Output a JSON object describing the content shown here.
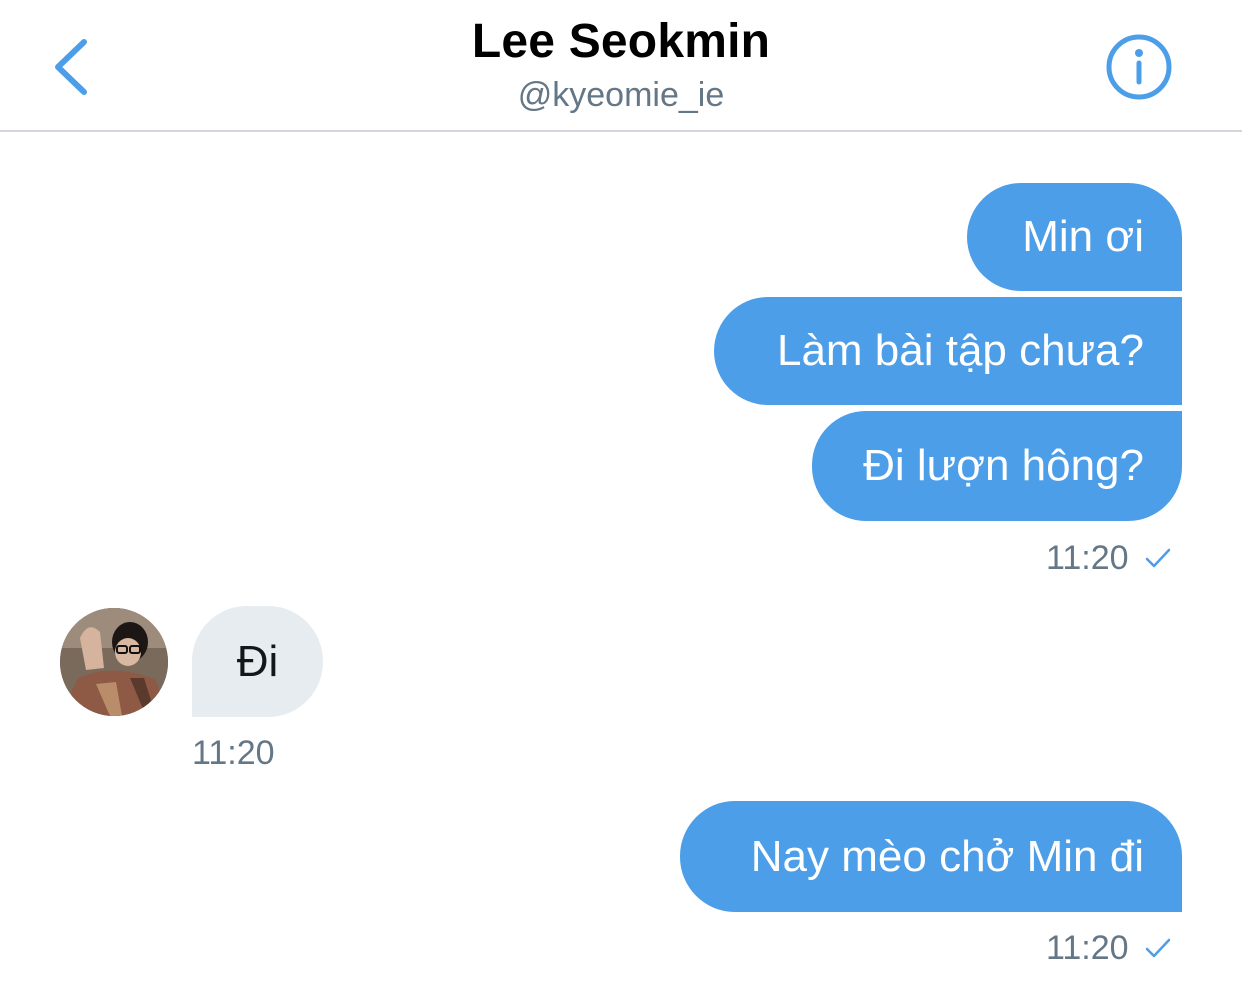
{
  "header": {
    "title": "Lee Seokmin",
    "handle": "@kyeomie_ie",
    "back_icon": "chevron-left-icon",
    "info_icon": "info-circle-icon"
  },
  "colors": {
    "accent": "#4c9ee8",
    "incoming_bubble": "#e6ecf0",
    "meta_text": "#657786"
  },
  "messages": [
    {
      "direction": "outgoing",
      "text": "Min ơi"
    },
    {
      "direction": "outgoing",
      "text": "Làm bài tập chưa?"
    },
    {
      "direction": "outgoing",
      "text": "Đi lượn hông?"
    },
    {
      "direction": "outgoing",
      "timestamp": "11:20",
      "status_icon": "check-icon"
    },
    {
      "direction": "incoming",
      "text": "Đi",
      "timestamp": "11:20"
    },
    {
      "direction": "outgoing",
      "text": "Nay mèo chở Min đi",
      "timestamp": "11:20",
      "status_icon": "check-icon"
    }
  ]
}
